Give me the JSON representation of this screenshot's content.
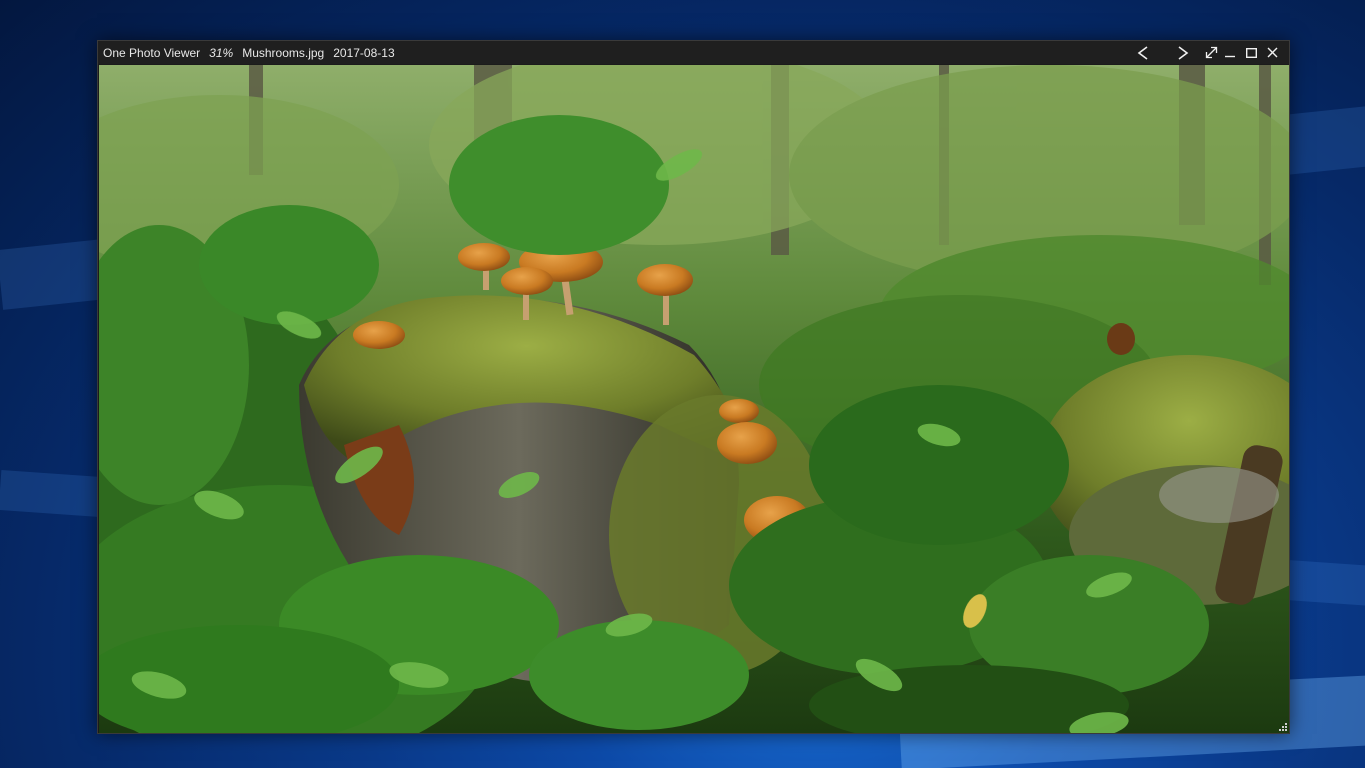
{
  "window": {
    "app_name": "One Photo Viewer",
    "zoom": "31%",
    "file_name": "Mushrooms.jpg",
    "date": "2017-08-13"
  },
  "controls": {
    "previous": "previous-icon",
    "next": "next-icon",
    "fullscreen": "fullscreen-icon",
    "minimize": "minimize-icon",
    "maximize": "maximize-icon",
    "close": "close-icon"
  },
  "photo": {
    "subject": "forest-mushrooms-photo"
  },
  "colors": {
    "titlebar_bg": "#1f1f1f",
    "title_text": "#e8e8e8",
    "desktop_blue": "#0a3a8a"
  }
}
